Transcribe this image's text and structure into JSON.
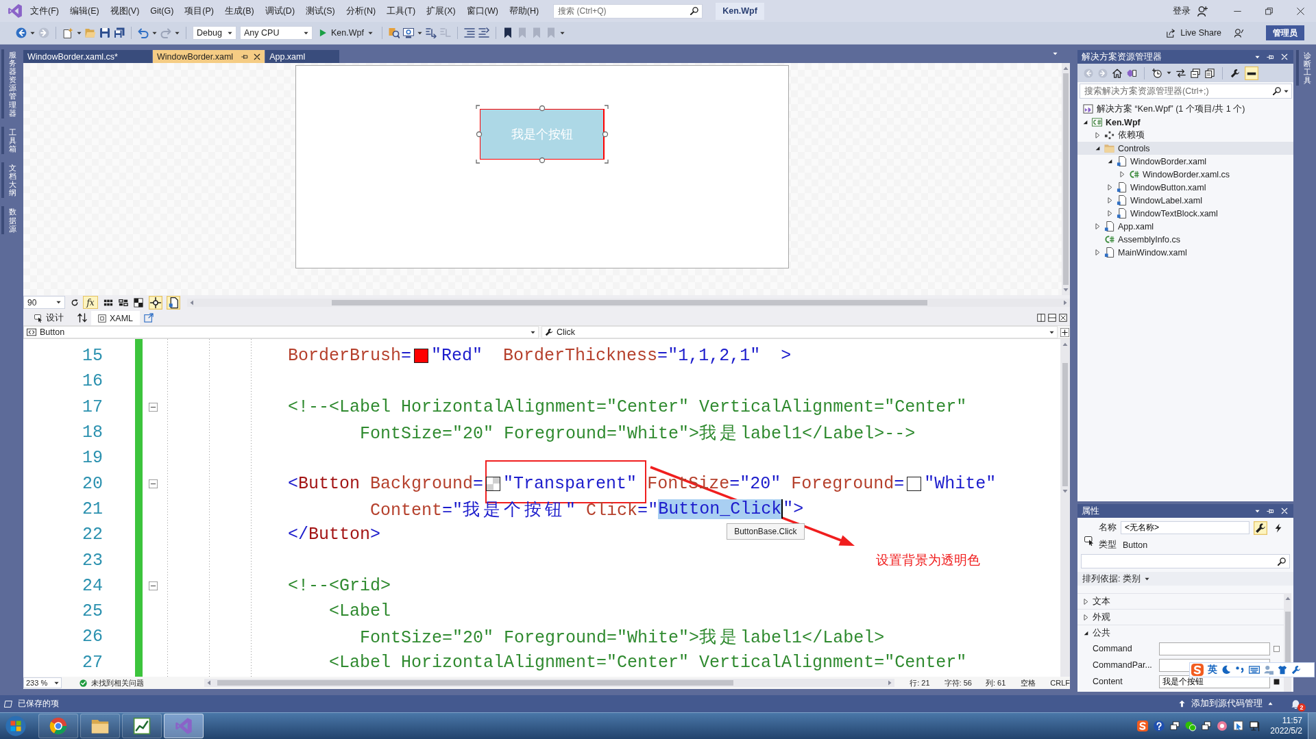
{
  "title_bar": {
    "menu": [
      "文件(F)",
      "编辑(E)",
      "视图(V)",
      "Git(G)",
      "项目(P)",
      "生成(B)",
      "调试(D)",
      "测试(S)",
      "分析(N)",
      "工具(T)",
      "扩展(X)",
      "窗口(W)",
      "帮助(H)"
    ],
    "search": {
      "placeholder": "搜索 (Ctrl+Q)"
    },
    "solution_name": "Ken.Wpf",
    "sign_in": "登录"
  },
  "toolbar": {
    "configuration": "Debug",
    "platform": "Any CPU",
    "start_target": "Ken.Wpf",
    "live_share": "Live Share",
    "admin_badge": "管理员"
  },
  "left_tool_tabs": [
    "服务器资源管理器",
    "工具箱",
    "文档大纲",
    "数据源"
  ],
  "document_tabs": [
    {
      "label": "WindowBorder.xaml.cs*",
      "selected": false
    },
    {
      "label": "WindowBorder.xaml",
      "selected": true
    },
    {
      "label": "App.xaml",
      "selected": false
    }
  ],
  "designer": {
    "preview_button": {
      "content": "我是个按钮",
      "selected": true
    },
    "zoom": "90",
    "formula_button": "fx",
    "view_tabs": [
      {
        "label": "设计",
        "selected": false
      },
      {
        "label": "XAML",
        "selected": true
      }
    ],
    "element_selector": "Button",
    "member_selector": "Click"
  },
  "editor": {
    "lines": [
      {
        "number": "15",
        "tokens": [
          {
            "kind": "attr",
            "text": "BorderBrush"
          },
          {
            "kind": "delim",
            "text": "="
          },
          {
            "kind": "swatch",
            "color": "#ff0000"
          },
          {
            "kind": "value",
            "text": "\"Red\""
          },
          {
            "kind": "attr",
            "text": "  BorderThickness"
          },
          {
            "kind": "delim",
            "text": "="
          },
          {
            "kind": "value",
            "text": "\"1,1,2,1\""
          },
          {
            "kind": "delim",
            "text": "  >"
          }
        ]
      },
      {
        "number": "16"
      },
      {
        "number": "17",
        "fold": {
          "expanded": true
        },
        "tokens": [
          {
            "kind": "comment",
            "text": "<!--<Label HorizontalAlignment=\"Center\" VerticalAlignment=\"Center\""
          }
        ]
      },
      {
        "number": "18",
        "tokens": [
          {
            "kind": "comment",
            "text": "       FontSize=\"20\" Foreground=\"White\">我是label1</Label>-->"
          }
        ]
      },
      {
        "number": "19"
      },
      {
        "number": "20",
        "fold": {
          "expanded": true
        },
        "tokens": [
          {
            "kind": "delim",
            "text": "<"
          },
          {
            "kind": "element",
            "text": "Button"
          },
          {
            "kind": "attr",
            "text": " Background"
          },
          {
            "kind": "delim",
            "text": "="
          },
          {
            "kind": "checker-swatch"
          },
          {
            "kind": "value",
            "text": "\"Transparent\""
          },
          {
            "kind": "attr",
            "text": " FontSize"
          },
          {
            "kind": "delim",
            "text": "="
          },
          {
            "kind": "value",
            "text": "\"20\""
          },
          {
            "kind": "attr",
            "text": " Foreground"
          },
          {
            "kind": "delim",
            "text": "="
          },
          {
            "kind": "swatch",
            "color": "#ffffff"
          },
          {
            "kind": "value",
            "text": "\"White\""
          }
        ]
      },
      {
        "number": "21",
        "tokens": [
          {
            "kind": "attr",
            "text": "        Content"
          },
          {
            "kind": "delim",
            "text": "="
          },
          {
            "kind": "value",
            "text": "\"我是个按钮\""
          },
          {
            "kind": "attr",
            "text": " Click"
          },
          {
            "kind": "delim",
            "text": "="
          },
          {
            "kind": "value",
            "text": "\""
          },
          {
            "kind": "value",
            "text": "Button_Click",
            "selected": true,
            "tooltip": "ButtonBase.Click"
          },
          {
            "kind": "value",
            "text": "\""
          },
          {
            "kind": "delim",
            "text": ">"
          }
        ]
      },
      {
        "number": "22",
        "tokens": [
          {
            "kind": "delim",
            "text": "</"
          },
          {
            "kind": "element",
            "text": "Button"
          },
          {
            "kind": "delim",
            "text": ">"
          }
        ]
      },
      {
        "number": "23"
      },
      {
        "number": "24",
        "fold": {
          "expanded": true
        },
        "tokens": [
          {
            "kind": "comment",
            "text": "<!--<Grid>"
          }
        ]
      },
      {
        "number": "25",
        "tokens": [
          {
            "kind": "comment",
            "text": "    <Label"
          }
        ]
      },
      {
        "number": "26",
        "tokens": [
          {
            "kind": "comment",
            "text": "       FontSize=\"20\" Foreground=\"White\">我是label1</Label>"
          }
        ]
      },
      {
        "number": "27",
        "tokens": [
          {
            "kind": "comment",
            "text": "    <Label HorizontalAlignment=\"Center\" VerticalAlignment=\"Center\""
          }
        ]
      }
    ],
    "status": {
      "zoom": "233 %",
      "issues": "未找到相关问题",
      "line": "行: 21",
      "character": "字符: 56",
      "column": "列: 61",
      "whitespace": "空格",
      "line_ending": "CRLF"
    }
  },
  "annotation": {
    "label": "设置背景为透明色"
  },
  "solution_explorer": {
    "title": "解决方案资源管理器",
    "search": {
      "placeholder": "搜索解决方案资源管理器(Ctrl+;)"
    },
    "tree": [
      {
        "label": "解决方案 “Ken.Wpf” (1 个项目/共 1 个)",
        "kind": "solution",
        "selected": false,
        "children": [
          {
            "label": "Ken.Wpf",
            "kind": "project",
            "expanded": true,
            "selected": false,
            "children": [
              {
                "label": "依赖项",
                "kind": "dependencies",
                "expanded": false,
                "selected": false
              },
              {
                "label": "Controls",
                "kind": "folder",
                "expanded": true,
                "selected": true,
                "children": [
                  {
                    "label": "WindowBorder.xaml",
                    "kind": "xaml",
                    "expanded": true,
                    "selected": false,
                    "children": [
                      {
                        "label": "WindowBorder.xaml.cs",
                        "kind": "cs",
                        "expanded": false,
                        "selected": false
                      }
                    ]
                  },
                  {
                    "label": "WindowButton.xaml",
                    "kind": "xaml",
                    "expanded": false,
                    "selected": false
                  },
                  {
                    "label": "WindowLabel.xaml",
                    "kind": "xaml",
                    "expanded": false,
                    "selected": false
                  },
                  {
                    "label": "WindowTextBlock.xaml",
                    "kind": "xaml",
                    "expanded": false,
                    "selected": false
                  }
                ]
              },
              {
                "label": "App.xaml",
                "kind": "xaml",
                "expanded": false,
                "selected": false
              },
              {
                "label": "AssemblyInfo.cs",
                "kind": "cs",
                "selected": false
              },
              {
                "label": "MainWindow.xaml",
                "kind": "xaml",
                "expanded": false,
                "selected": false
              }
            ]
          }
        ]
      }
    ]
  },
  "properties": {
    "title": "属性",
    "name_label": "名称",
    "name": "<无名称>",
    "type_label": "类型",
    "type": "Button",
    "sort": "排列依据: 类别",
    "categories": [
      {
        "label": "文本",
        "expanded": false
      },
      {
        "label": "外观",
        "expanded": false
      },
      {
        "label": "公共",
        "expanded": true,
        "properties": [
          {
            "name": "Command",
            "local_value": false
          },
          {
            "name": "CommandPar..."
          },
          {
            "name": "Content",
            "value": "我是个按钮",
            "local_value": true
          }
        ]
      }
    ]
  },
  "right_tool_tabs": [
    "诊断工具"
  ],
  "status_bar": {
    "message": "已保存的项",
    "source_control": "添加到源代码管理",
    "notifications": "2"
  },
  "ime_toolbar": {
    "mode": "英"
  },
  "taskbar": {
    "apps": [
      {
        "kind": "browser",
        "selected": false
      },
      {
        "kind": "files",
        "selected": false
      },
      {
        "kind": "chart",
        "selected": false
      },
      {
        "kind": "ide",
        "selected": true
      }
    ],
    "time": "11:57",
    "date": "2022/5/2"
  }
}
